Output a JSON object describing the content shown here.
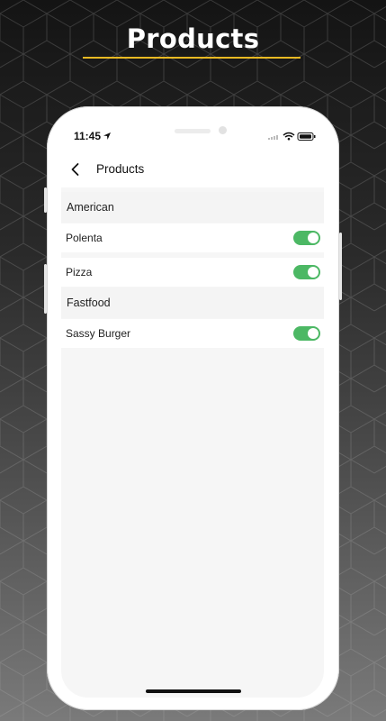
{
  "headline": "Products",
  "colors": {
    "accent_underline": "#e8b923",
    "toggle_on": "#4cb864",
    "background_top": "#141414",
    "background_bottom": "#7a7a7a"
  },
  "status_bar": {
    "time": "11:45",
    "icons": [
      "location-arrow-icon",
      "signal-icon",
      "wifi-icon",
      "battery-icon"
    ]
  },
  "nav": {
    "back_icon": "chevron-left-icon",
    "title": "Products"
  },
  "sections": [
    {
      "name": "American",
      "items": [
        {
          "label": "Polenta",
          "enabled": true
        },
        {
          "label": "Pizza",
          "enabled": true
        }
      ]
    },
    {
      "name": "Fastfood",
      "items": [
        {
          "label": "Sassy Burger",
          "enabled": true
        }
      ]
    }
  ]
}
